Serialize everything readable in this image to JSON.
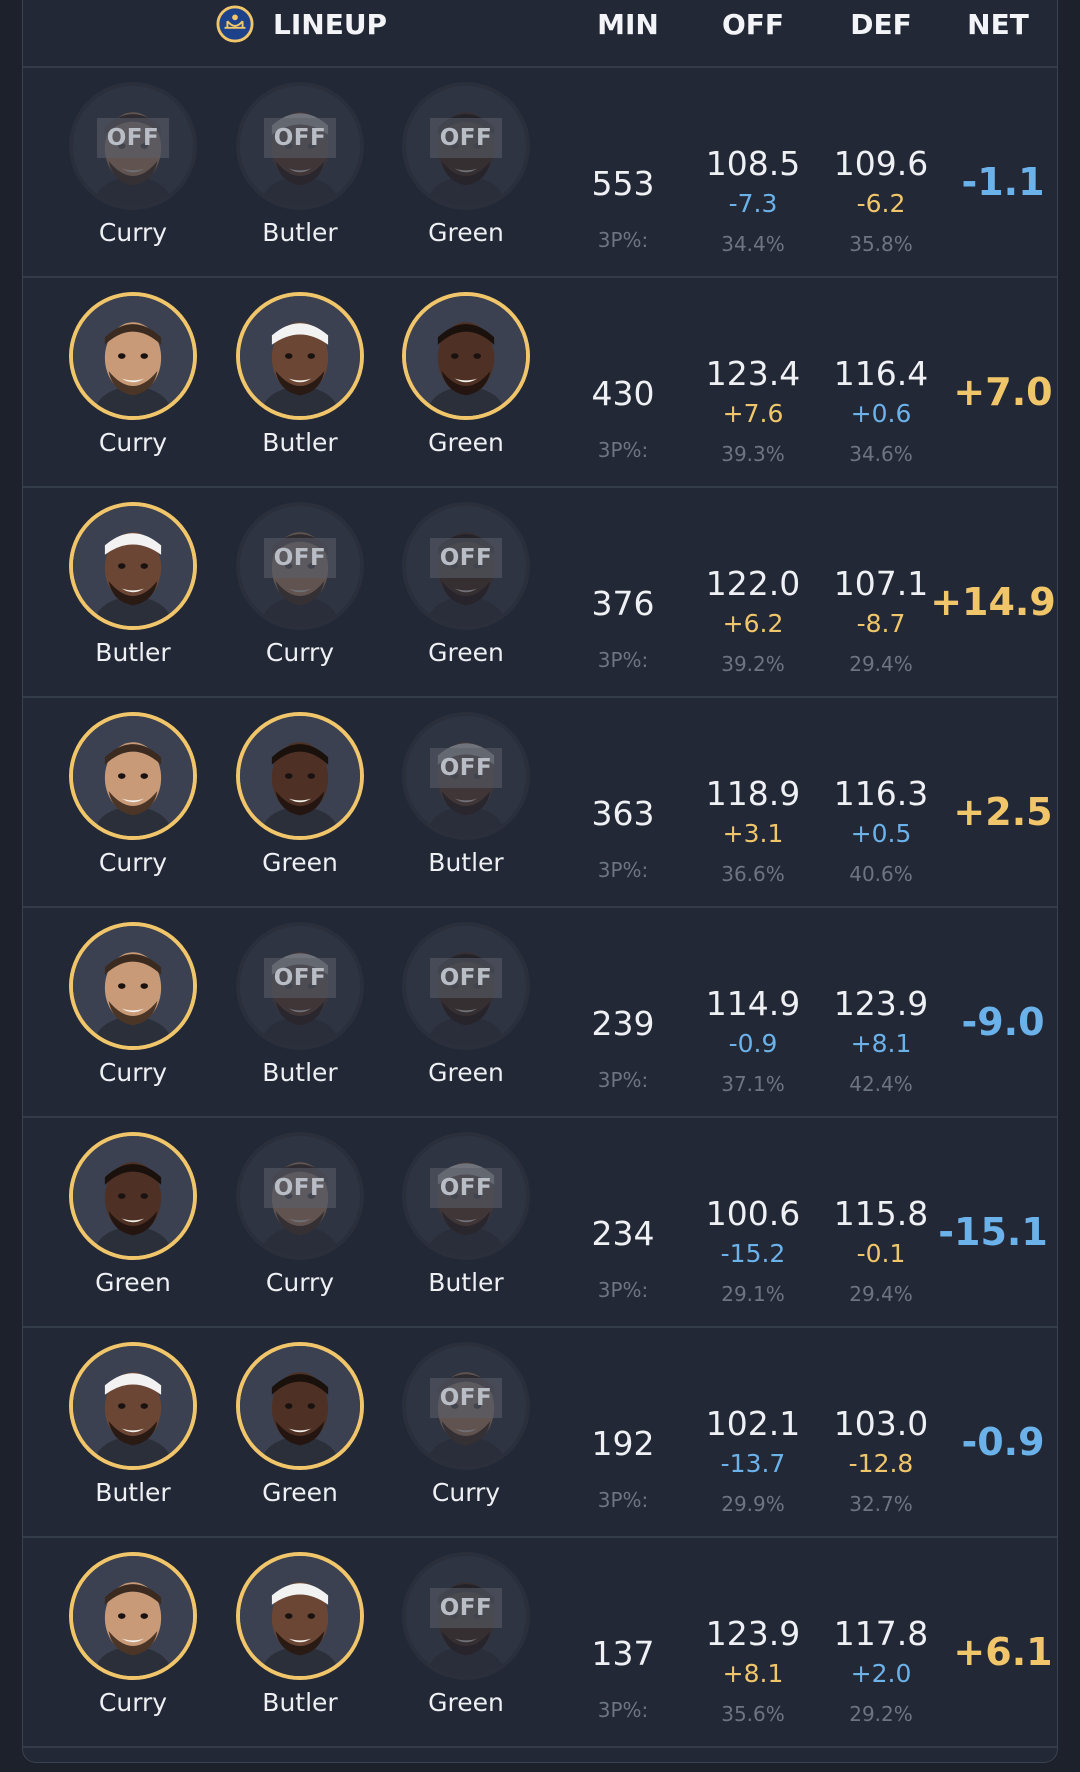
{
  "header": {
    "team_logo": "warriors-logo",
    "lineup_label": "LINEUP",
    "min_label": "MIN",
    "off_label": "OFF",
    "def_label": "DEF",
    "net_label": "NET"
  },
  "colors": {
    "accent_on": "#f1c66b",
    "positive": "#f1c66b",
    "negative": "#6cb2ea"
  },
  "off_tag": "OFF",
  "three_pt_label": "3P%:",
  "rows": [
    {
      "players": [
        {
          "name": "Curry",
          "on": false
        },
        {
          "name": "Butler",
          "on": false
        },
        {
          "name": "Green",
          "on": false
        }
      ],
      "min": "553",
      "off": {
        "value": "108.5",
        "diff": "-7.3",
        "diff_sign": "neg",
        "pct": "34.4%"
      },
      "def": {
        "value": "109.6",
        "diff": "-6.2",
        "diff_sign": "pos",
        "pct": "35.8%"
      },
      "net": "-1.1",
      "net_sign": "neg"
    },
    {
      "players": [
        {
          "name": "Curry",
          "on": true
        },
        {
          "name": "Butler",
          "on": true
        },
        {
          "name": "Green",
          "on": true
        }
      ],
      "min": "430",
      "off": {
        "value": "123.4",
        "diff": "+7.6",
        "diff_sign": "pos",
        "pct": "39.3%"
      },
      "def": {
        "value": "116.4",
        "diff": "+0.6",
        "diff_sign": "neg",
        "pct": "34.6%"
      },
      "net": "+7.0",
      "net_sign": "pos"
    },
    {
      "players": [
        {
          "name": "Butler",
          "on": true
        },
        {
          "name": "Curry",
          "on": false
        },
        {
          "name": "Green",
          "on": false
        }
      ],
      "min": "376",
      "off": {
        "value": "122.0",
        "diff": "+6.2",
        "diff_sign": "pos",
        "pct": "39.2%"
      },
      "def": {
        "value": "107.1",
        "diff": "-8.7",
        "diff_sign": "pos",
        "pct": "29.4%"
      },
      "net": "+14.9",
      "net_sign": "pos"
    },
    {
      "players": [
        {
          "name": "Curry",
          "on": true
        },
        {
          "name": "Green",
          "on": true
        },
        {
          "name": "Butler",
          "on": false
        }
      ],
      "min": "363",
      "off": {
        "value": "118.9",
        "diff": "+3.1",
        "diff_sign": "pos",
        "pct": "36.6%"
      },
      "def": {
        "value": "116.3",
        "diff": "+0.5",
        "diff_sign": "neg",
        "pct": "40.6%"
      },
      "net": "+2.5",
      "net_sign": "pos"
    },
    {
      "players": [
        {
          "name": "Curry",
          "on": true
        },
        {
          "name": "Butler",
          "on": false
        },
        {
          "name": "Green",
          "on": false
        }
      ],
      "min": "239",
      "off": {
        "value": "114.9",
        "diff": "-0.9",
        "diff_sign": "neg",
        "pct": "37.1%"
      },
      "def": {
        "value": "123.9",
        "diff": "+8.1",
        "diff_sign": "neg",
        "pct": "42.4%"
      },
      "net": "-9.0",
      "net_sign": "neg"
    },
    {
      "players": [
        {
          "name": "Green",
          "on": true
        },
        {
          "name": "Curry",
          "on": false
        },
        {
          "name": "Butler",
          "on": false
        }
      ],
      "min": "234",
      "off": {
        "value": "100.6",
        "diff": "-15.2",
        "diff_sign": "neg",
        "pct": "29.1%"
      },
      "def": {
        "value": "115.8",
        "diff": "-0.1",
        "diff_sign": "pos",
        "pct": "29.4%"
      },
      "net": "-15.1",
      "net_sign": "neg"
    },
    {
      "players": [
        {
          "name": "Butler",
          "on": true
        },
        {
          "name": "Green",
          "on": true
        },
        {
          "name": "Curry",
          "on": false
        }
      ],
      "min": "192",
      "off": {
        "value": "102.1",
        "diff": "-13.7",
        "diff_sign": "neg",
        "pct": "29.9%"
      },
      "def": {
        "value": "103.0",
        "diff": "-12.8",
        "diff_sign": "pos",
        "pct": "32.7%"
      },
      "net": "-0.9",
      "net_sign": "neg"
    },
    {
      "players": [
        {
          "name": "Curry",
          "on": true
        },
        {
          "name": "Butler",
          "on": true
        },
        {
          "name": "Green",
          "on": false
        }
      ],
      "min": "137",
      "off": {
        "value": "123.9",
        "diff": "+8.1",
        "diff_sign": "pos",
        "pct": "35.6%"
      },
      "def": {
        "value": "117.8",
        "diff": "+2.0",
        "diff_sign": "neg",
        "pct": "29.2%"
      },
      "net": "+6.1",
      "net_sign": "pos"
    }
  ]
}
